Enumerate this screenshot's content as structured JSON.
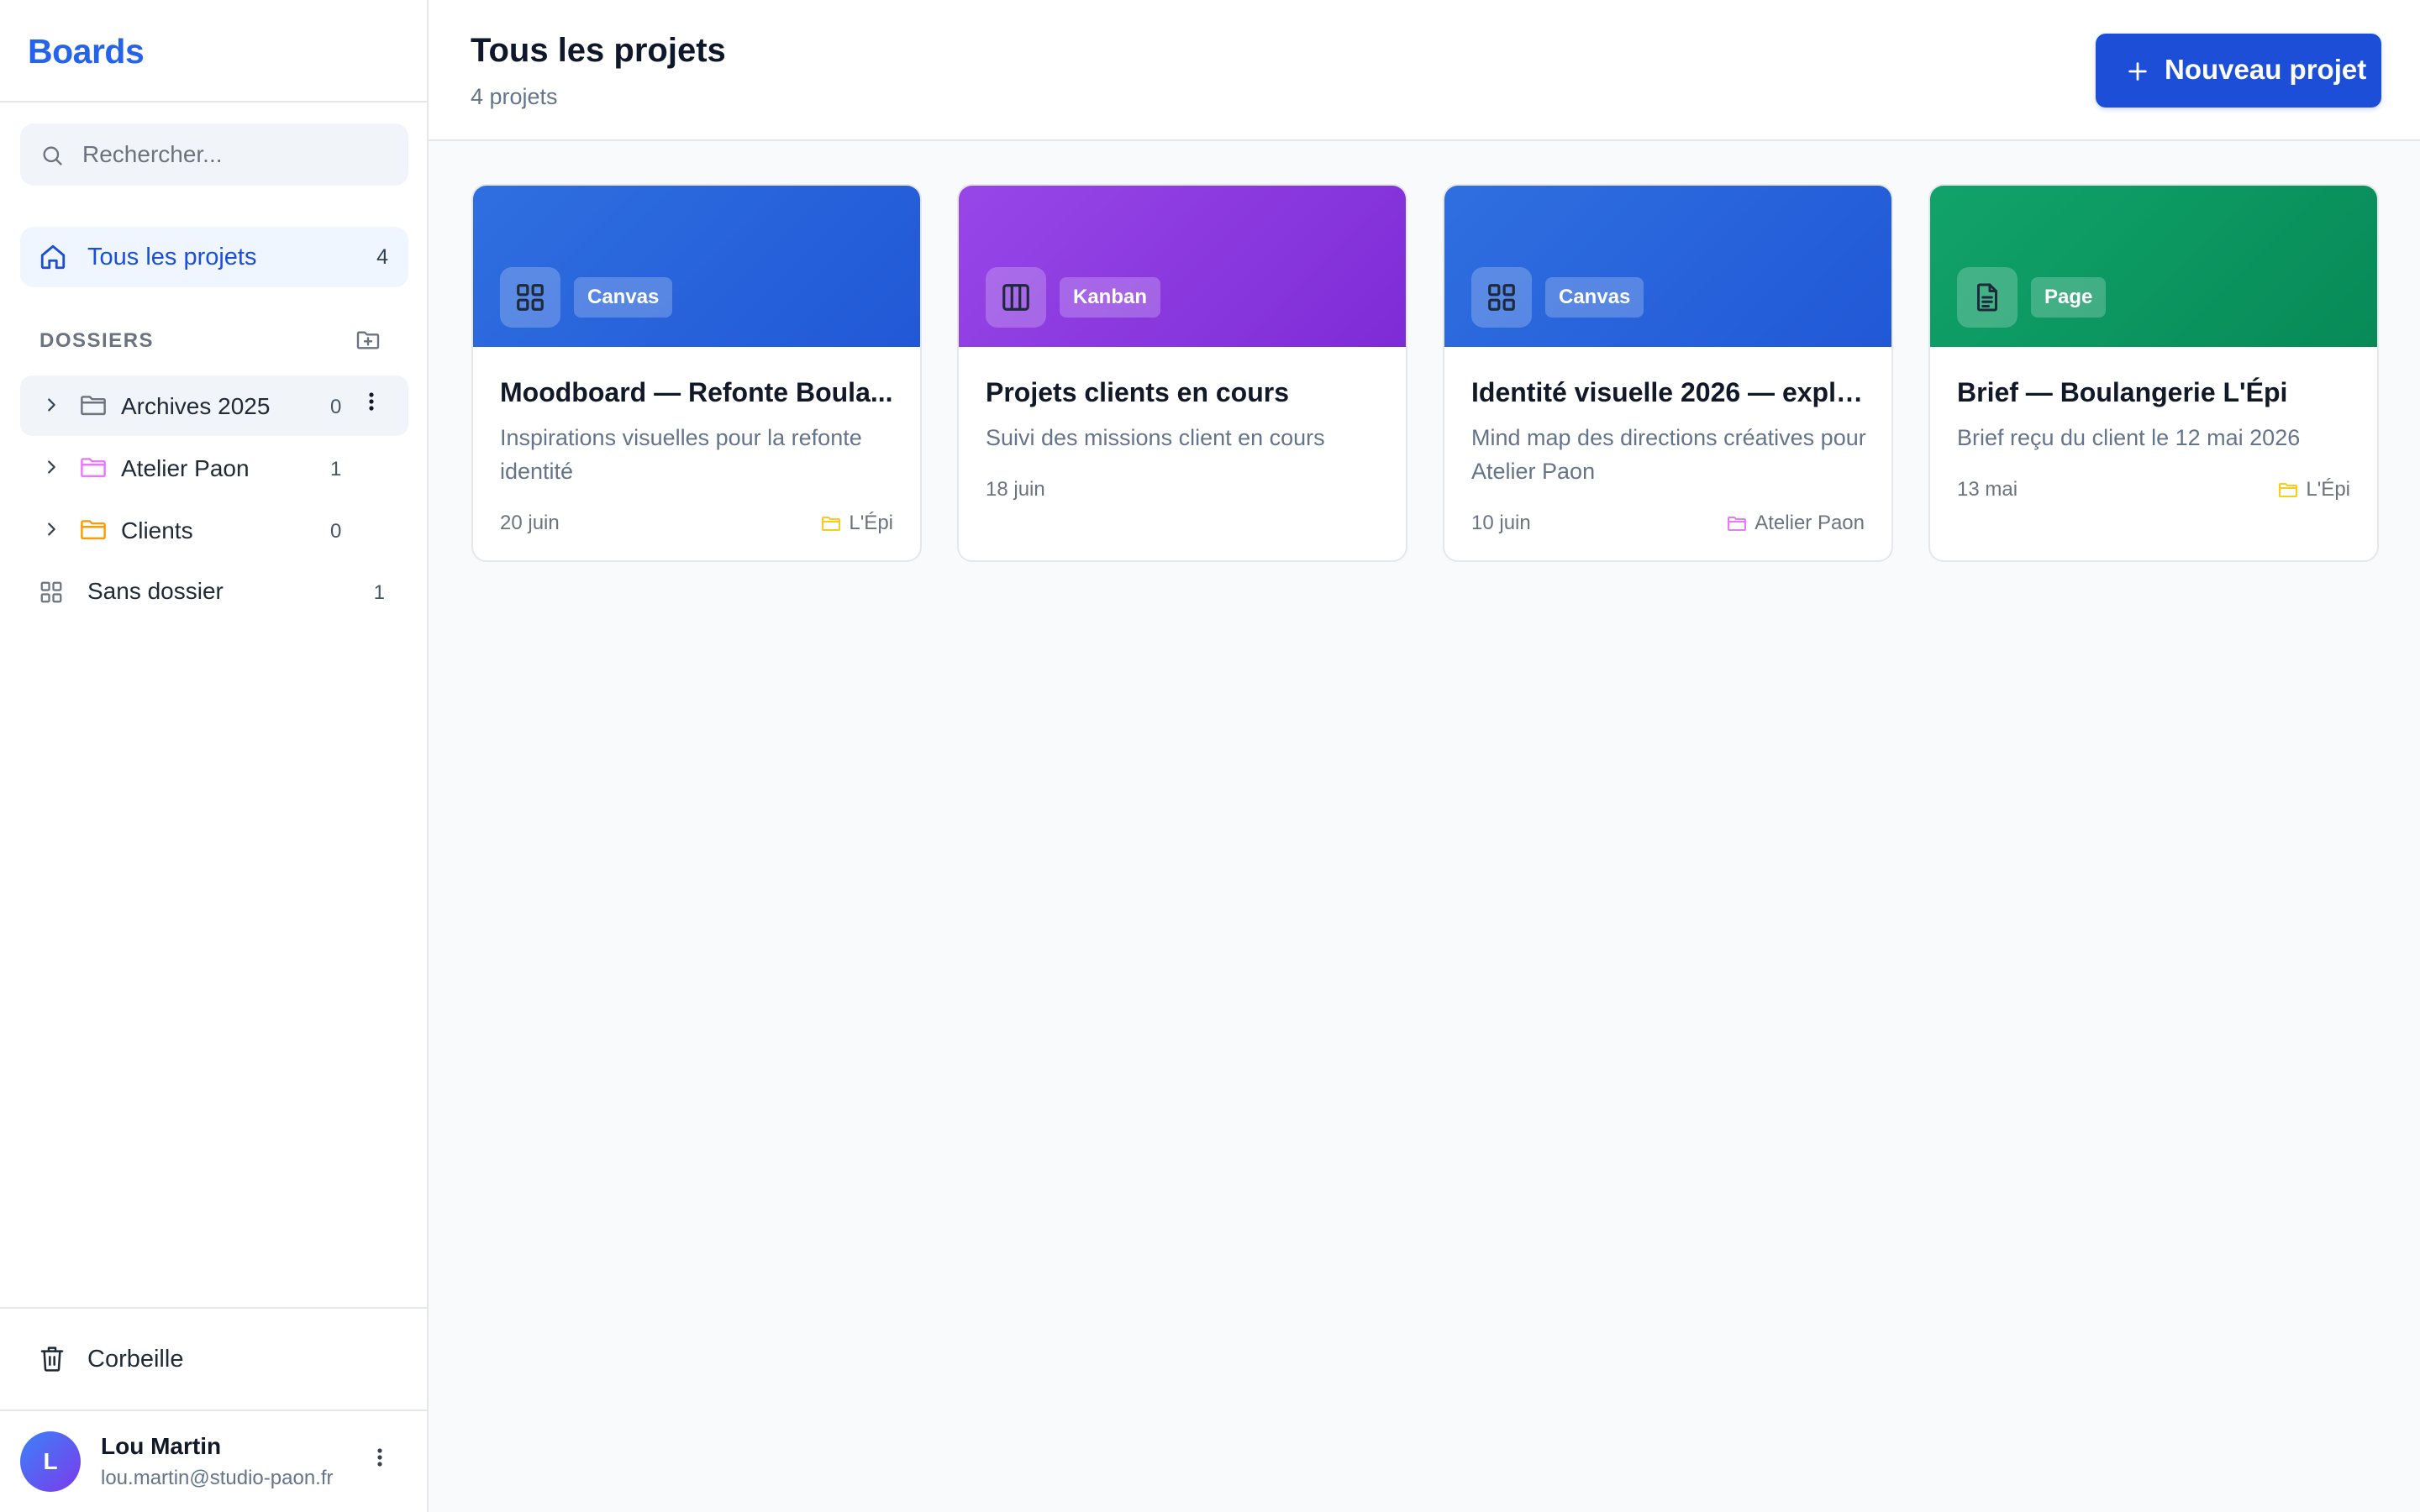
{
  "sidebar": {
    "brand": "Boards",
    "search_placeholder": "Rechercher...",
    "nav_all": {
      "label": "Tous les projets",
      "count": "4"
    },
    "section_title": "DOSSIERS",
    "folders": [
      {
        "label": "Archives 2025",
        "count": "0",
        "color": "#6b7280"
      },
      {
        "label": "Atelier Paon",
        "count": "1",
        "color": "#e879f9"
      },
      {
        "label": "Clients",
        "count": "0",
        "color": "#f59e0b"
      }
    ],
    "no_folder": {
      "label": "Sans dossier",
      "count": "1"
    },
    "trash": "Corbeille",
    "user": {
      "initial": "L",
      "name": "Lou Martin",
      "email": "lou.martin@studio-paon.fr"
    }
  },
  "header": {
    "title": "Tous les projets",
    "subtitle": "4 projets",
    "new_button": "Nouveau projet"
  },
  "cards": [
    {
      "type": "Canvas",
      "icon": "grid-icon",
      "color": "#2563eb",
      "title": "Moodboard — Refonte Boula...",
      "description": "Inspirations visuelles pour la refonte identité",
      "date": "20 juin",
      "folder": "L'Épi",
      "folder_color": "#facc15"
    },
    {
      "type": "Kanban",
      "icon": "columns-icon",
      "color": "#9333ea",
      "title": "Projets clients en cours",
      "description": "Suivi des missions client en cours",
      "date": "18 juin",
      "folder": "",
      "folder_color": ""
    },
    {
      "type": "Canvas",
      "icon": "grid-icon",
      "color": "#2563eb",
      "title": "Identité visuelle 2026 — explo...",
      "description": "Mind map des directions créatives pour Atelier Paon",
      "date": "10 juin",
      "folder": "Atelier Paon",
      "folder_color": "#e879f9"
    },
    {
      "type": "Page",
      "icon": "document-icon",
      "color": "#059669",
      "title": "Brief — Boulangerie L'Épi",
      "description": "Brief reçu du client le 12 mai 2026",
      "date": "13 mai",
      "folder": "L'Épi",
      "folder_color": "#facc15"
    }
  ]
}
